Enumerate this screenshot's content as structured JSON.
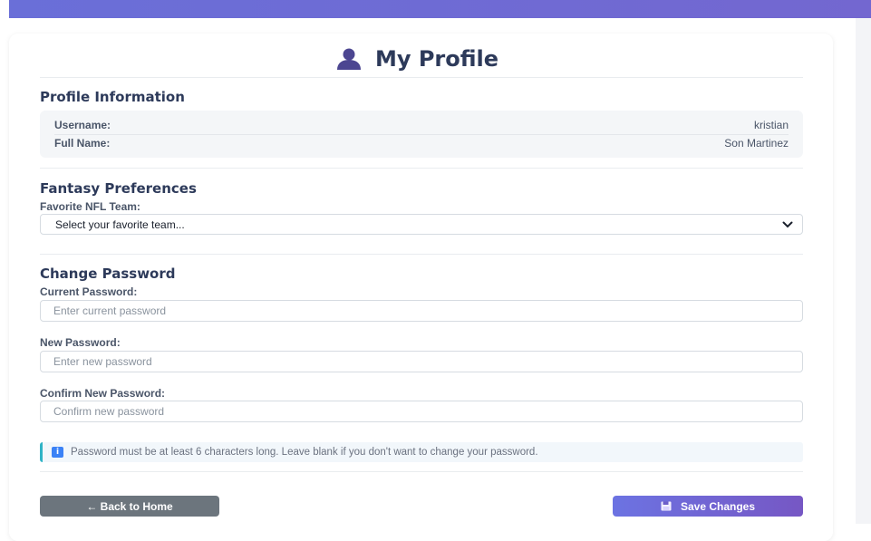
{
  "page": {
    "title": "My Profile",
    "title_icon": "user-icon"
  },
  "profile_info": {
    "heading": "Profile Information",
    "username_label": "Username:",
    "username_value": "kristian",
    "fullname_label": "Full Name:",
    "fullname_value": "Son Martinez"
  },
  "fantasy": {
    "heading": "Fantasy Preferences",
    "team_label": "Favorite NFL Team:",
    "team_selected": "Select your favorite team..."
  },
  "password": {
    "heading": "Change Password",
    "current_label": "Current Password:",
    "current_placeholder": "Enter current password",
    "new_label": "New Password:",
    "new_placeholder": "Enter new password",
    "confirm_label": "Confirm New Password:",
    "confirm_placeholder": "Confirm new password",
    "note": "Password must be at least 6 characters long. Leave blank if you don't want to change your password."
  },
  "actions": {
    "back_label": "← Back to Home",
    "save_label": "Save Changes"
  },
  "colors": {
    "accent": "#6c73e2",
    "accent_dark": "#7657c4",
    "heading": "#2d3a5a",
    "back_button": "#6c757d",
    "note_border": "#2fb3c6"
  }
}
